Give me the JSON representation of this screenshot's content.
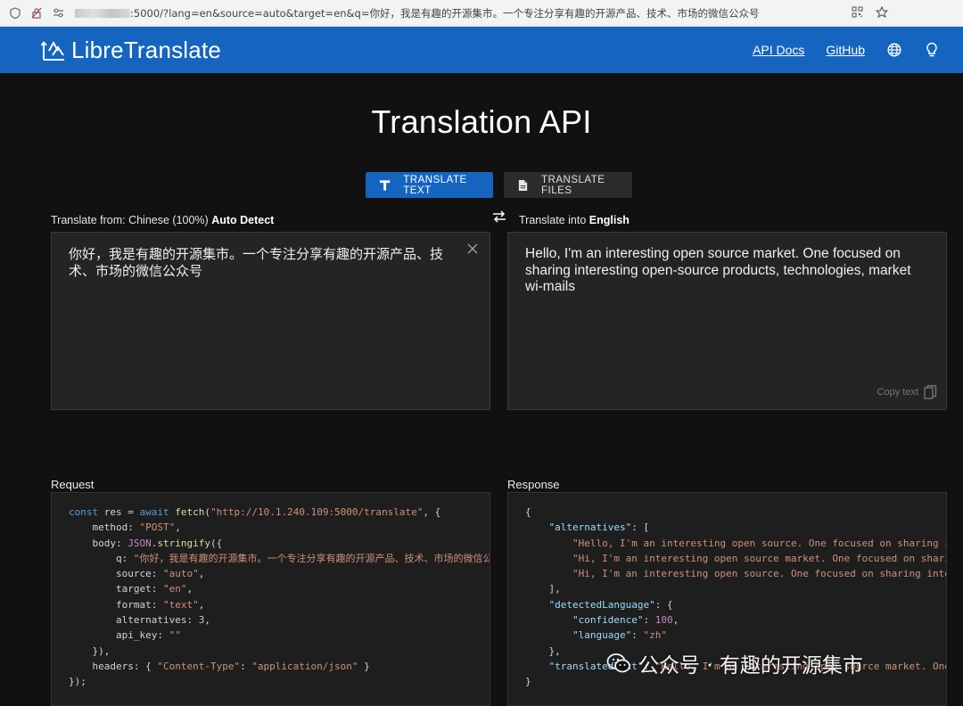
{
  "browser": {
    "url_suffix": ":5000/?lang=en&source=auto&target=en&q=你好，我是有趣的开源集市。一个专注分享有趣的开源产品、技术、市场的微信公众号"
  },
  "navbar": {
    "brand": "LibreTranslate",
    "links": [
      "API Docs",
      "GitHub"
    ],
    "color": "#1565c0"
  },
  "page": {
    "title": "Translation API",
    "modes": [
      "TRANSLATE TEXT",
      "TRANSLATE FILES"
    ]
  },
  "source": {
    "label_prefix": "Translate from:",
    "language": "Chinese (100%)",
    "detect": "Auto Detect",
    "text": "你好，我是有趣的开源集市。一个专注分享有趣的开源产品、技术、市场的微信公众号"
  },
  "target": {
    "label_prefix": "Translate into",
    "language": "English",
    "text": "Hello, I'm an interesting open source market. One focused on sharing interesting open-source products, technologies, market wi-mails",
    "copy_label": "Copy text"
  },
  "request": {
    "label": "Request",
    "url": "\"http://10.1.240.109:5000/translate\"",
    "method": "\"POST\"",
    "q": "\"你好，我是有趣的开源集市。一个专注分享有趣的开源产品、技术、市场的微信公众号\"",
    "source": "\"auto\"",
    "target": "\"en\"",
    "format": "\"text\"",
    "alternatives": "3",
    "api_key": "\"\"",
    "content_type_key": "\"Content-Type\"",
    "content_type_val": "\"application/json\""
  },
  "response": {
    "label": "Response",
    "alternatives": [
      "\"Hello, I'm an interesting open source. One focused on sharing interesting open-source products, technologies, market wi-mails\"",
      "\"Hi, I'm an interesting open source market. One focused on sharing interesting open-source products, technologies, market wi-mails\"",
      "\"Hi, I'm an interesting open source. One focused on sharing interesting open-source products, technologies, market wi-mails\""
    ],
    "confidence": "100",
    "language": "\"zh\"",
    "translated": "\"Hello, I'm an interesting open source market. One focused on sharing interesting open-source products, technologies, market wi-mails\""
  },
  "watermark": {
    "text": "公众号 · 有趣的开源集市"
  }
}
